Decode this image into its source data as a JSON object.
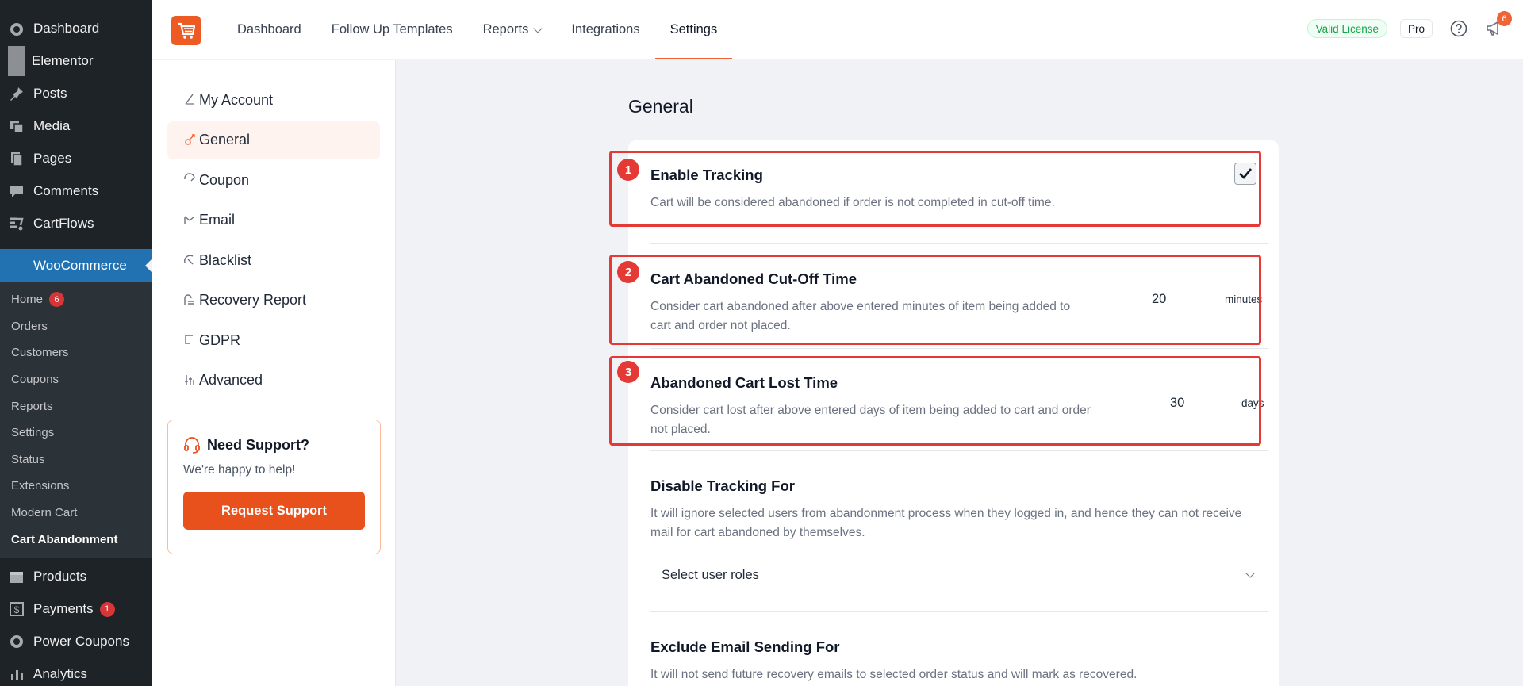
{
  "wp_sidebar": {
    "top_items": [
      {
        "label": "Dashboard",
        "icon": "dashboard-icon"
      },
      {
        "label": "Elementor",
        "icon": "elementor-icon"
      },
      {
        "label": "Posts",
        "icon": "pin-icon"
      },
      {
        "label": "Media",
        "icon": "media-icon"
      },
      {
        "label": "Pages",
        "icon": "pages-icon"
      },
      {
        "label": "Comments",
        "icon": "comment-icon"
      },
      {
        "label": "CartFlows",
        "icon": "cartflows-icon"
      }
    ],
    "woocommerce": {
      "label": "WooCommerce"
    },
    "woo_sub": [
      {
        "label": "Home",
        "badge": "6"
      },
      {
        "label": "Orders"
      },
      {
        "label": "Customers"
      },
      {
        "label": "Coupons"
      },
      {
        "label": "Reports"
      },
      {
        "label": "Settings"
      },
      {
        "label": "Status"
      },
      {
        "label": "Extensions"
      },
      {
        "label": "Modern Cart"
      },
      {
        "label": "Cart Abandonment"
      }
    ],
    "bottom_items": [
      {
        "label": "Products",
        "icon": "products-icon"
      },
      {
        "label": "Payments",
        "icon": "payments-icon",
        "badge": "1"
      },
      {
        "label": "Power Coupons",
        "icon": "power-coupons-icon"
      },
      {
        "label": "Analytics",
        "icon": "analytics-icon"
      }
    ]
  },
  "topbar": {
    "nav": [
      {
        "label": "Dashboard"
      },
      {
        "label": "Follow Up Templates"
      },
      {
        "label": "Reports"
      },
      {
        "label": "Integrations"
      },
      {
        "label": "Settings"
      }
    ],
    "license": "Valid License",
    "plan": "Pro",
    "notifications": "6",
    "accent": "#f06335"
  },
  "settings_nav": {
    "items": [
      {
        "label": "My Account",
        "icon": "account-icon"
      },
      {
        "label": "General",
        "icon": "general-icon"
      },
      {
        "label": "Coupon",
        "icon": "coupon-icon"
      },
      {
        "label": "Email",
        "icon": "email-icon"
      },
      {
        "label": "Blacklist",
        "icon": "blacklist-icon"
      },
      {
        "label": "Recovery Report",
        "icon": "recovery-report-icon"
      },
      {
        "label": "GDPR",
        "icon": "gdpr-icon"
      },
      {
        "label": "Advanced",
        "icon": "advanced-icon"
      }
    ],
    "support": {
      "title": "Need Support?",
      "subtitle": "We're happy to help!",
      "button": "Request Support"
    }
  },
  "main": {
    "title": "General",
    "fields": {
      "tracking": {
        "title": "Enable Tracking",
        "desc": "Cart will be considered abandoned if order is not completed in cut-off time.",
        "checked": true
      },
      "cutoff": {
        "title": "Cart Abandoned Cut-Off Time",
        "desc": "Consider cart abandoned after above entered minutes of item being added to cart and order not placed.",
        "value": "20",
        "unit": "minutes"
      },
      "lost": {
        "title": "Abandoned Cart Lost Time",
        "desc": "Consider cart lost after above entered days of item being added to cart and order not placed.",
        "value": "30",
        "unit": "days"
      },
      "disable": {
        "title": "Disable Tracking For",
        "desc": "It will ignore selected users from abandonment process when they logged in, and hence they can not receive mail for cart abandoned by themselves.",
        "select_placeholder": "Select user roles"
      },
      "exclude": {
        "title": "Exclude Email Sending For",
        "desc": "It will not send future recovery emails to selected order status and will mark as recovered."
      }
    }
  },
  "annotations": [
    "1",
    "2",
    "3"
  ]
}
